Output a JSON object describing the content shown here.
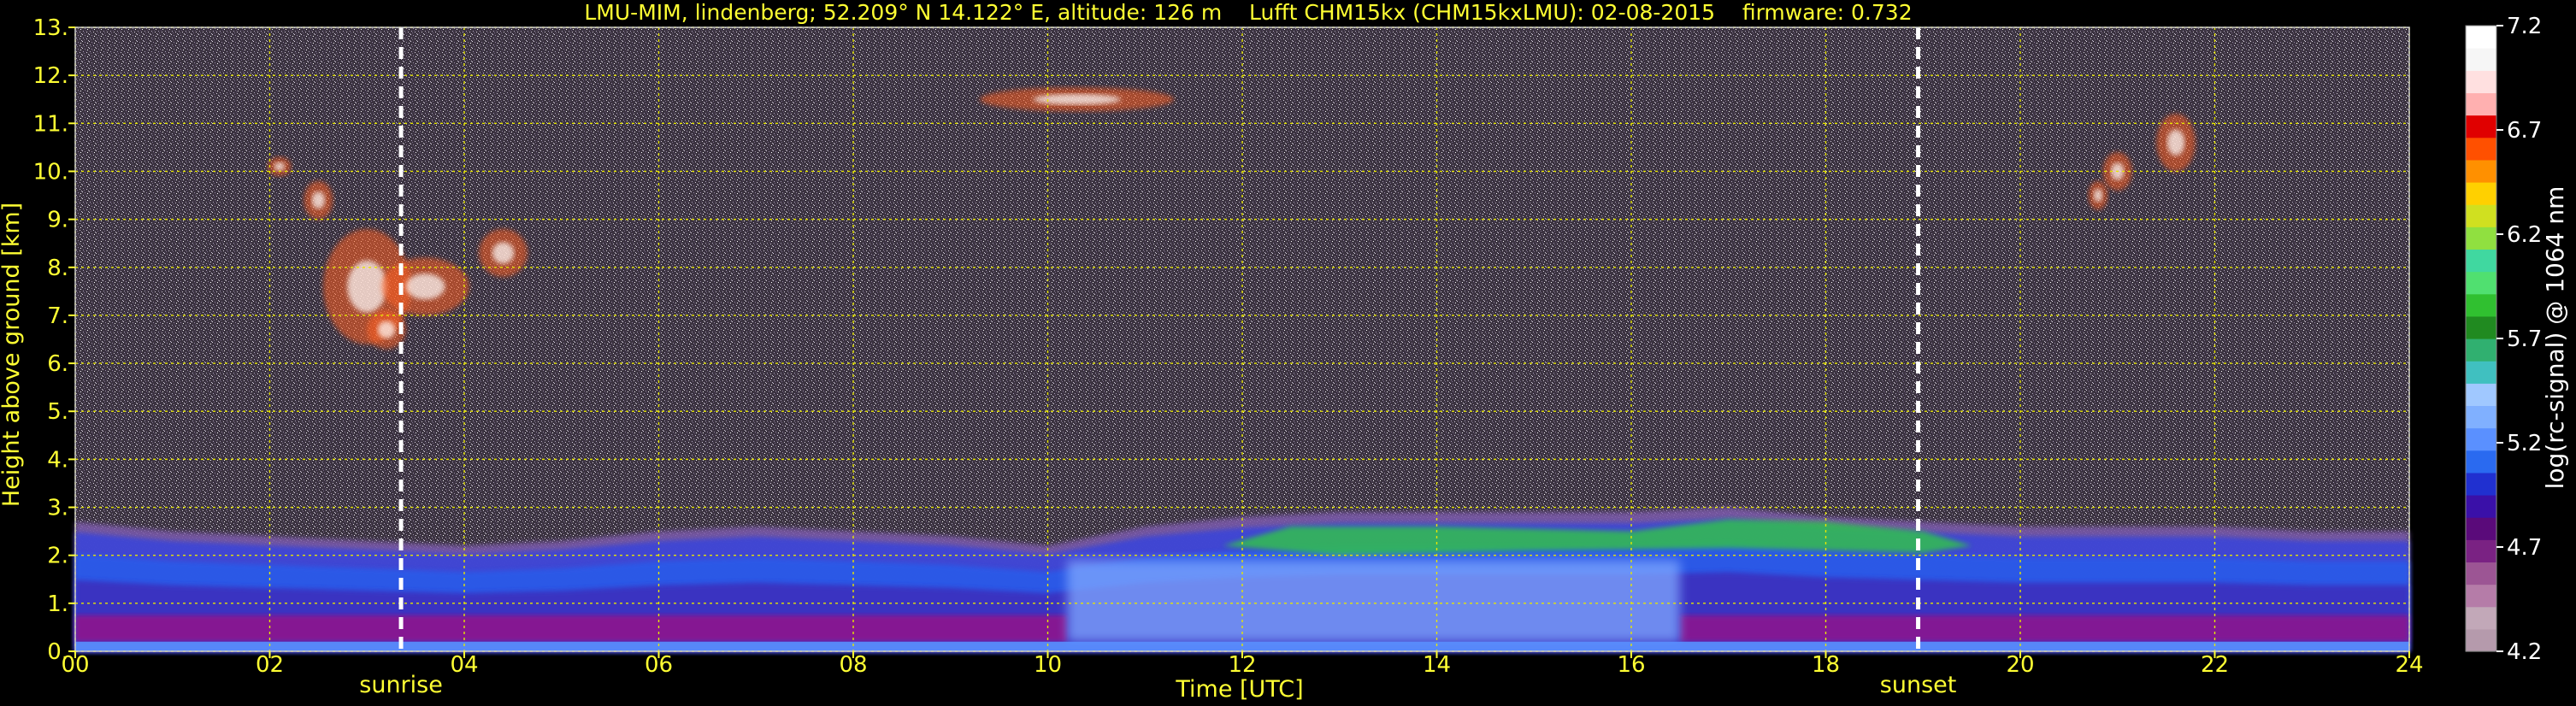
{
  "chart_data": {
    "type": "heatmap",
    "title": "LMU-MIM, lindenberg; 52.209° N 14.122° E, altitude: 126 m    Lufft CHM15kx (CHM15kxLMU): 02-08-2015    firmware: 0.732",
    "xlabel": "Time [UTC]",
    "ylabel": "Height above ground [km]",
    "xlim": [
      0,
      24
    ],
    "ylim": [
      0,
      13
    ],
    "x_ticks": [
      "00",
      "02",
      "04",
      "06",
      "08",
      "10",
      "12",
      "14",
      "16",
      "18",
      "20",
      "22",
      "24"
    ],
    "x_tick_values": [
      0,
      2,
      4,
      6,
      8,
      10,
      12,
      14,
      16,
      18,
      20,
      22,
      24
    ],
    "y_ticks": [
      "0.",
      "1.",
      "2.",
      "3.",
      "4.",
      "5.",
      "6.",
      "7.",
      "8.",
      "9.",
      "10.",
      "11.",
      "12.",
      "13."
    ],
    "y_tick_values": [
      0,
      1,
      2,
      3,
      4,
      5,
      6,
      7,
      8,
      9,
      10,
      11,
      12,
      13
    ],
    "grid": true,
    "markers": [
      {
        "label": "sunrise",
        "x": 3.35
      },
      {
        "label": "sunset",
        "x": 18.95
      }
    ],
    "colorbar": {
      "label": "log(rc-signal) @ 1064 nm",
      "range": [
        4.2,
        7.2
      ],
      "ticks": [
        "4.2",
        "4.7",
        "5.2",
        "5.7",
        "6.2",
        "6.7",
        "7.2"
      ],
      "tick_values": [
        4.2,
        4.7,
        5.2,
        5.7,
        6.2,
        6.7,
        7.2
      ],
      "colors": [
        "#b59aac",
        "#c2a8b8",
        "#b57ca8",
        "#9c5594",
        "#7a2283",
        "#5a0a7a",
        "#3a10a8",
        "#2030d0",
        "#2a6af0",
        "#5a90ff",
        "#80b0ff",
        "#a0c8ff",
        "#40c0c0",
        "#30b070",
        "#208a20",
        "#30c030",
        "#50e070",
        "#40d8a0",
        "#90e040",
        "#d0e020",
        "#ffd000",
        "#ff9000",
        "#ff5000",
        "#e00000",
        "#ffb0b0",
        "#ffe0e0",
        "#f6f6f6",
        "#ffffff"
      ]
    },
    "features": [
      {
        "kind": "boundary-layer",
        "x": [
          0,
          24
        ],
        "top_km": [
          2.7,
          2.5,
          2.4,
          2.3,
          2.2,
          2.3,
          2.5,
          2.6,
          2.5,
          2.4,
          2.2,
          2.6,
          2.8,
          2.9,
          2.9,
          2.9,
          2.9,
          3.0,
          2.8,
          2.7,
          2.6,
          2.6,
          2.6,
          2.5,
          2.5
        ]
      },
      {
        "kind": "cirrus",
        "x_range": [
          2.0,
          4.8
        ],
        "y_range_km": [
          6.3,
          10.5
        ]
      },
      {
        "kind": "cirrus",
        "x_range": [
          9.3,
          11.5
        ],
        "y_range_km": [
          11.0,
          12.0
        ]
      },
      {
        "kind": "cirrus",
        "x_range": [
          20.6,
          21.9
        ],
        "y_range_km": [
          9.5,
          11.3
        ]
      }
    ]
  }
}
